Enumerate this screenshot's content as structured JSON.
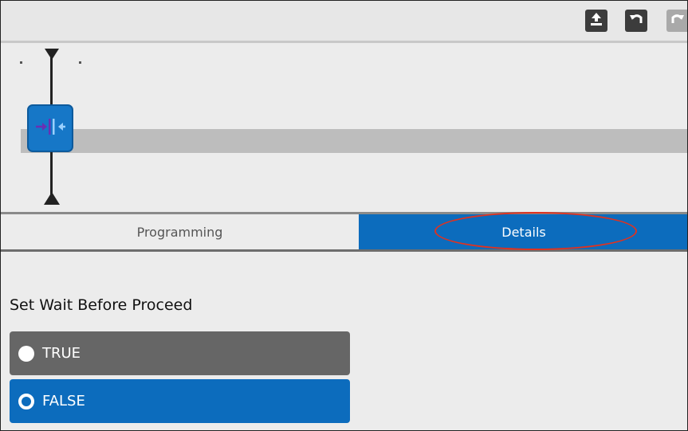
{
  "toolbar": {
    "buttons": [
      {
        "icon": "upload-icon",
        "enabled": true
      },
      {
        "icon": "undo-icon",
        "enabled": true
      },
      {
        "icon": "redo-icon",
        "enabled": false
      }
    ]
  },
  "timeline": {
    "node_icon": "merge-arrows-icon"
  },
  "tabs": [
    {
      "label": "Programming",
      "active": false
    },
    {
      "label": "Details",
      "active": true,
      "highlighted": true
    }
  ],
  "details": {
    "setting_label": "Set Wait Before Proceed",
    "options": [
      {
        "label": "TRUE",
        "selected": false
      },
      {
        "label": "FALSE",
        "selected": true
      }
    ]
  },
  "colors": {
    "accent": "#0c6cbd",
    "option_inactive": "#666666",
    "highlight_ellipse": "#e0321f",
    "track": "#bdbdbd"
  }
}
